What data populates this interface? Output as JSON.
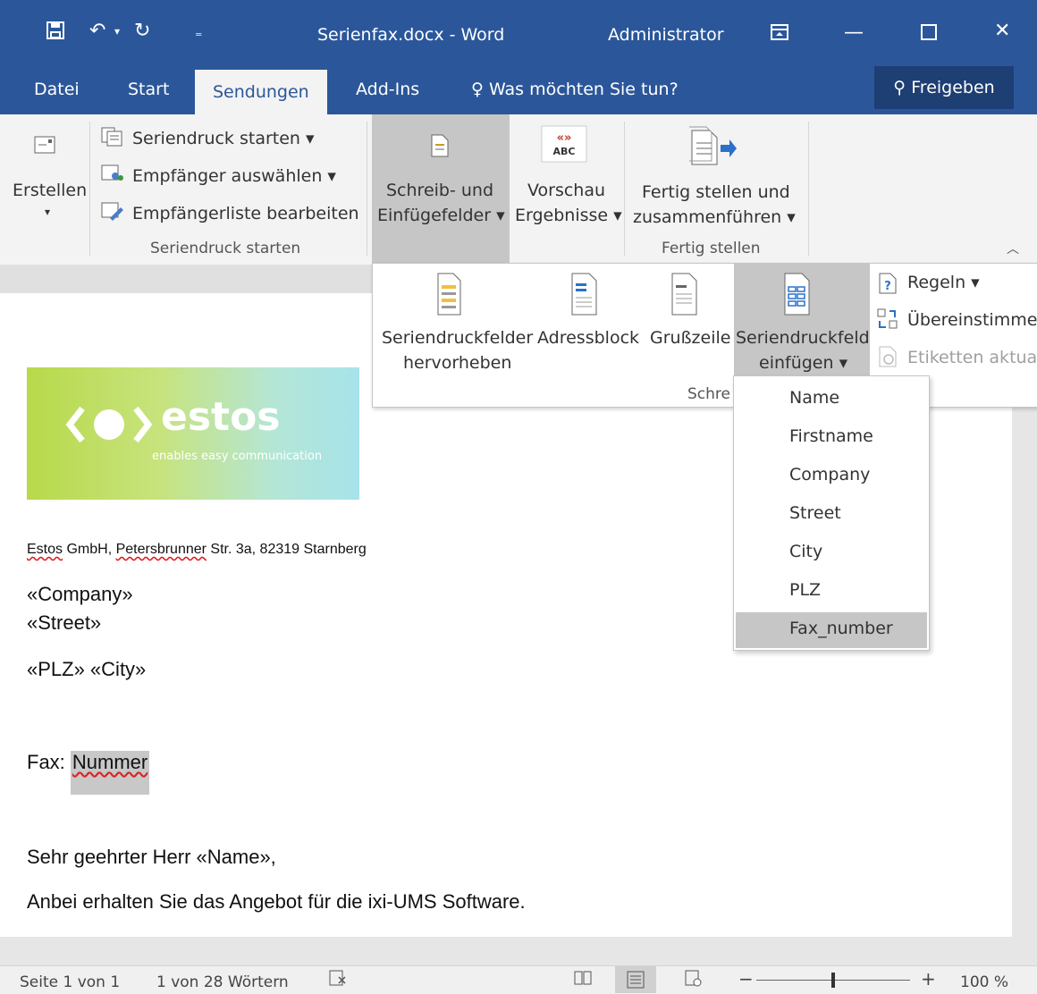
{
  "window": {
    "title": "Serienfax.docx  -  Word",
    "user": "Administrator"
  },
  "tabs": {
    "datei": "Datei",
    "start": "Start",
    "sendungen": "Sendungen",
    "addins": "Add-Ins",
    "tell_me": "Was möchten Sie tun?",
    "share": "Freigeben"
  },
  "ribbon": {
    "erstellen": "Erstellen",
    "seriendruck_starten": "Seriendruck starten",
    "empfaenger_auswaehlen": "Empfänger auswählen",
    "empfaengerliste": "Empfängerliste bearbeiten",
    "group_seriendruck": "Seriendruck starten",
    "schreib_l1": "Schreib- und",
    "schreib_l2": "Einfügefelder",
    "vorschau_l1": "Vorschau",
    "vorschau_l2": "Ergebnisse",
    "fertig_l1": "Fertig stellen und",
    "fertig_l2": "zusammenführen",
    "group_fertig": "Fertig stellen"
  },
  "panel": {
    "hervorheben_l1": "Seriendruckfelder",
    "hervorheben_l2": "hervorheben",
    "adressblock": "Adressblock",
    "grusszeile": "Grußzeile",
    "einfuegen_l1": "Seriendruckfeld",
    "einfuegen_l2": "einfügen",
    "regeln": "Regeln",
    "uebereinstimmen": "Übereinstimme",
    "etiketten": "Etiketten aktual",
    "group_partial": "Schre"
  },
  "menu": {
    "items": [
      "Name",
      "Firstname",
      "Company",
      "Street",
      "City",
      "PLZ",
      "Fax_number"
    ],
    "selected_index": 6
  },
  "document": {
    "logo_text": "estos",
    "logo_tagline": "enables easy communication",
    "sender_a": "Estos",
    "sender_b": " GmbH, ",
    "sender_c": "Petersbrunner",
    "sender_d": " Str.  3a, 82319 Starnberg",
    "company": "«Company»",
    "street": "«Street»",
    "plz_city": "«PLZ» «City»",
    "fax_label": "Fax: ",
    "fax_value": "Nummer",
    "salutation": "Sehr geehrter Herr  «Name»,",
    "body": "Anbei erhalten Sie das Angebot für die ixi-UMS Software."
  },
  "status": {
    "page": "Seite 1 von 1",
    "words": "1 von 28 Wörtern",
    "zoom": "100 %",
    "zoom_level": 0.5
  }
}
